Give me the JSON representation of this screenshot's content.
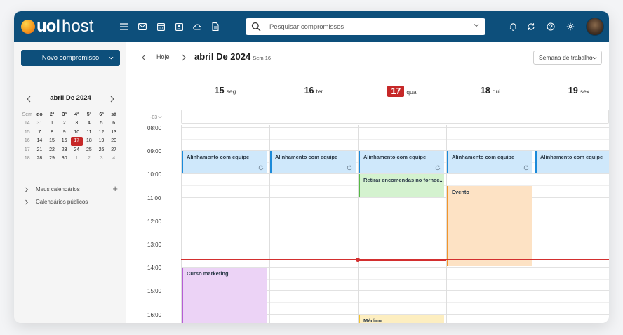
{
  "app": {
    "logo_main": "uol",
    "logo_sub": "host"
  },
  "topbar": {
    "icons": [
      "menu-icon",
      "mail-icon",
      "calendar-icon",
      "contacts-icon",
      "cloud-icon",
      "document-icon",
      "bell-icon",
      "sync-icon",
      "help-icon",
      "settings-icon"
    ],
    "search_placeholder": "Pesquisar compromissos"
  },
  "sidebar": {
    "new_button": "Novo compromisso",
    "mini_calendar": {
      "title": "abril De 2024",
      "headers": [
        "Sem",
        "do",
        "2ª",
        "3ª",
        "4ª",
        "5ª",
        "6ª",
        "sá"
      ],
      "weeks": [
        {
          "wk": "14",
          "days": [
            "31",
            "1",
            "2",
            "3",
            "4",
            "5",
            "6"
          ]
        },
        {
          "wk": "15",
          "days": [
            "7",
            "8",
            "9",
            "10",
            "11",
            "12",
            "13"
          ]
        },
        {
          "wk": "16",
          "days": [
            "14",
            "15",
            "16",
            "17",
            "18",
            "19",
            "20"
          ]
        },
        {
          "wk": "17",
          "days": [
            "21",
            "22",
            "23",
            "24",
            "25",
            "26",
            "27"
          ]
        },
        {
          "wk": "18",
          "days": [
            "28",
            "29",
            "30",
            "1",
            "2",
            "3",
            "4"
          ]
        }
      ],
      "today": "17"
    },
    "my_calendars": "Meus calendários",
    "public_calendars": "Calendários públicos"
  },
  "calendar": {
    "today_label": "Hoje",
    "title": "abril De 2024",
    "week_label": "Sem 16",
    "view_label": "Semana de trabalho",
    "timezone": "-03",
    "days": [
      {
        "num": "15",
        "name": "seg"
      },
      {
        "num": "16",
        "name": "ter"
      },
      {
        "num": "17",
        "name": "qua"
      },
      {
        "num": "18",
        "name": "qui"
      },
      {
        "num": "19",
        "name": "sex"
      }
    ],
    "today_index": 2,
    "hours": [
      "08:00",
      "09:00",
      "10:00",
      "11:00",
      "12:00",
      "13:00",
      "14:00",
      "15:00",
      "16:00"
    ],
    "events": [
      {
        "title": "Alinhamento com equipe",
        "day": 0,
        "start": "09:00",
        "end": "10:00",
        "color": "blue",
        "recurring": true
      },
      {
        "title": "Alinhamento com equipe",
        "day": 1,
        "start": "09:00",
        "end": "10:00",
        "color": "blue",
        "recurring": true
      },
      {
        "title": "Alinhamento com equipe",
        "day": 2,
        "start": "09:00",
        "end": "10:00",
        "color": "blue",
        "recurring": true
      },
      {
        "title": "Alinhamento com equipe",
        "day": 3,
        "start": "09:00",
        "end": "10:00",
        "color": "blue",
        "recurring": true
      },
      {
        "title": "Alinhamento com equipe",
        "day": 4,
        "start": "09:00",
        "end": "10:00",
        "color": "blue",
        "recurring": true
      },
      {
        "title": "Retirar encomendas no fornec...",
        "day": 2,
        "start": "10:00",
        "end": "11:00",
        "color": "green",
        "recurring": false
      },
      {
        "title": "Evento",
        "day": 3,
        "start": "10:30",
        "end": "14:00",
        "color": "orange",
        "recurring": false
      },
      {
        "title": "Curso marketing",
        "day": 0,
        "start": "14:00",
        "end": "17:00",
        "color": "purple",
        "recurring": false
      },
      {
        "title": "Médico",
        "day": 2,
        "start": "16:00",
        "end": "17:00",
        "color": "yellow",
        "recurring": false
      }
    ],
    "now_time": "13:40"
  }
}
